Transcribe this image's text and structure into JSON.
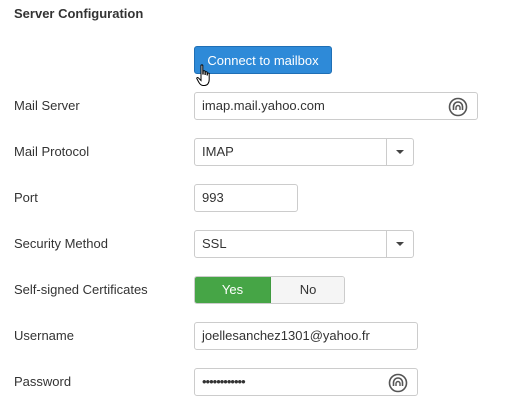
{
  "section": {
    "title": "Server Configuration"
  },
  "connect_button": {
    "label": "Connect to mailbox"
  },
  "mail_server": {
    "label": "Mail Server",
    "value": "imap.mail.yahoo.com",
    "icon": "password-manager-icon"
  },
  "mail_protocol": {
    "label": "Mail Protocol",
    "value": "IMAP"
  },
  "port": {
    "label": "Port",
    "value": "993"
  },
  "security_method": {
    "label": "Security Method",
    "value": "SSL"
  },
  "self_signed": {
    "label": "Self-signed Certificates",
    "yes_label": "Yes",
    "no_label": "No",
    "selected": "Yes"
  },
  "username": {
    "label": "Username",
    "value": "joellesanchez1301@yahoo.fr"
  },
  "password": {
    "label": "Password",
    "value": "••••••••••••",
    "icon": "password-manager-icon"
  },
  "colors": {
    "primary_button": "#2e8ad8",
    "toggle_active": "#46a546"
  }
}
